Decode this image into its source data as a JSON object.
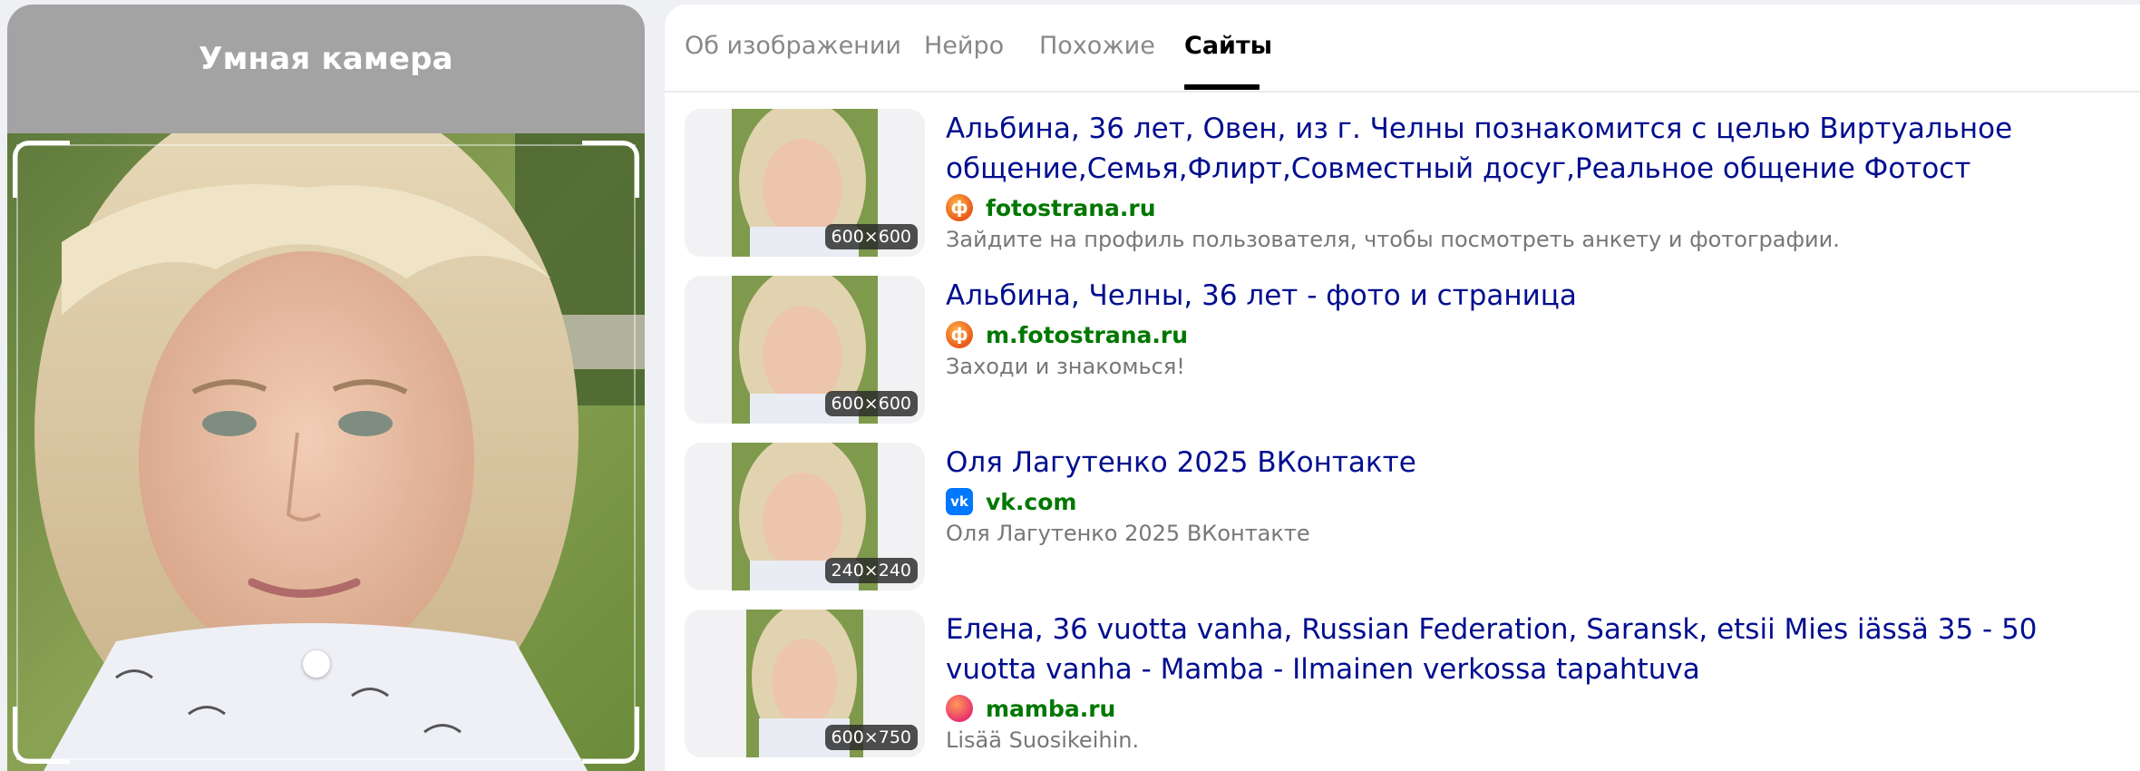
{
  "camera": {
    "title": "Умная камера"
  },
  "tabs": [
    {
      "label": "Об изображении",
      "active": false
    },
    {
      "label": "Нейро",
      "active": false
    },
    {
      "label": "Похожие",
      "active": false
    },
    {
      "label": "Сайты",
      "active": true
    }
  ],
  "results": [
    {
      "title": "Альбина, 36 лет, Овен, из г. Челны познакомится с целью Виртуальное общение,Семья,Флирт,Совместный досуг,Реальное общение Фотост",
      "domain": "fotostrana.ru",
      "favicon": "fotostrana-icon",
      "favicon_glyph": "ф",
      "description": "Зайдите на профиль пользователя, чтобы посмотреть анкету и фотографии.",
      "size": "600×600"
    },
    {
      "title": "Альбина, Челны, 36 лет - фото и страница",
      "domain": "m.fotostrana.ru",
      "favicon": "fotostrana-icon",
      "favicon_glyph": "ф",
      "description": "Заходи и знакомься!",
      "size": "600×600"
    },
    {
      "title": "Оля Лагутенко 2025 ВКонтакте",
      "domain": "vk.com",
      "favicon": "vk-icon",
      "favicon_glyph": "vk",
      "description": "Оля Лагутенко 2025 ВКонтакте",
      "size": "240×240"
    },
    {
      "title": "Елена, 36 vuotta vanha, Russian Federation, Saransk, etsii Mies iässä 35 - 50 vuotta vanha - Mamba - Ilmainen verkossa tapahtuva",
      "domain": "mamba.ru",
      "favicon": "mamba-icon",
      "favicon_glyph": "",
      "description": "Lisää Suosikeihin.",
      "size": "600×750"
    }
  ],
  "colors": {
    "link_title": "#000e8f",
    "domain": "#007700",
    "muted": "#777777",
    "camera_header": "#a3a3a3"
  }
}
